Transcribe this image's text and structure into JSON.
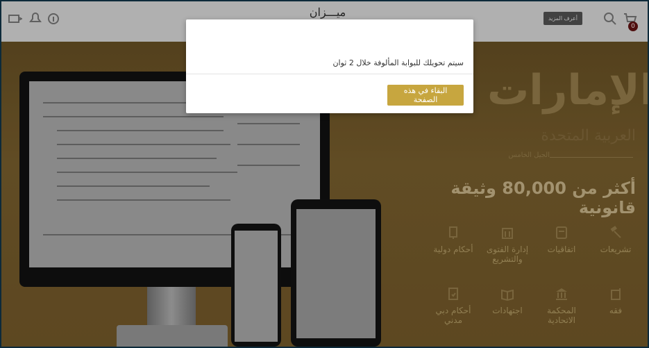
{
  "header": {
    "brand": "ميـــزان",
    "login_label": "أعرف المزيد",
    "cart_count": "0",
    "icons": [
      "user-icon",
      "bell-icon",
      "info-icon",
      "search-icon",
      "cart-icon"
    ]
  },
  "hero": {
    "title": "الإمارات",
    "subtitle": "العربية المتحدة",
    "edition": "الجيل الخامس",
    "tagline": "أكثر من 80,000 وثيقة قانونية",
    "features": [
      {
        "label": "تشريعات",
        "icon": "gavel-icon"
      },
      {
        "label": "اتفاقيات",
        "icon": "document-icon"
      },
      {
        "label": "إدارة الفتوى والتشريع",
        "icon": "building-icon"
      },
      {
        "label": "أحكام دولية",
        "icon": "scale-icon"
      },
      {
        "label": "فقه",
        "icon": "book-icon"
      },
      {
        "label": "المحكمة الاتحادية",
        "icon": "courthouse-icon"
      },
      {
        "label": "اجتهادات",
        "icon": "open-book-icon"
      },
      {
        "label": "أحكام دبي مدني",
        "icon": "file-icon"
      }
    ]
  },
  "modal": {
    "message": "سيتم تحويلك للبوابة المألوفة خلال 2 ثوان",
    "stay_button": "البقاء في هذه الصفحة"
  }
}
